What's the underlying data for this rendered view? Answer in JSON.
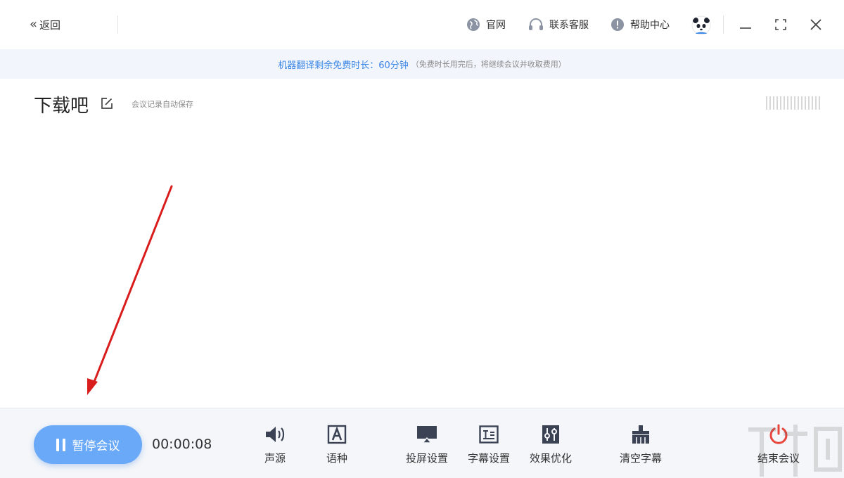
{
  "titlebar": {
    "back_label": "返回",
    "links": [
      {
        "label": "官网",
        "icon": "globe-icon"
      },
      {
        "label": "联系客服",
        "icon": "headset-icon"
      },
      {
        "label": "帮助中心",
        "icon": "info-icon"
      }
    ],
    "avatar": "panda-avatar",
    "window_controls": [
      "minimize-icon",
      "maximize-icon",
      "close-icon"
    ]
  },
  "notice": {
    "main_text": "机器翻译剩余免费时长：",
    "value": "60分钟",
    "sub_text": "（免费时长用完后，将继续会议并收取费用）"
  },
  "meeting": {
    "title": "下载吧",
    "autosave_text": "会议记录自动保存"
  },
  "bottom": {
    "pause_label": "暂停会议",
    "timer": "00:00:08",
    "tools": [
      {
        "label": "声源",
        "icon": "speaker-icon"
      },
      {
        "label": "语种",
        "icon": "language-icon"
      },
      {
        "label": "投屏设置",
        "icon": "cast-icon"
      },
      {
        "label": "字幕设置",
        "icon": "subtitle-icon"
      },
      {
        "label": "效果优化",
        "icon": "sliders-icon"
      },
      {
        "label": "清空字幕",
        "icon": "broom-icon"
      }
    ],
    "end_label": "结束会议"
  },
  "colors": {
    "accent": "#3a86e6",
    "pause_button": "#6aa9f7",
    "notice_bg": "#f2f6fc",
    "toolbar_bg": "#f4f6f9",
    "end_red": "#e8453c",
    "icon_dark": "#3b4254",
    "annotation_red": "#d91c1c"
  }
}
